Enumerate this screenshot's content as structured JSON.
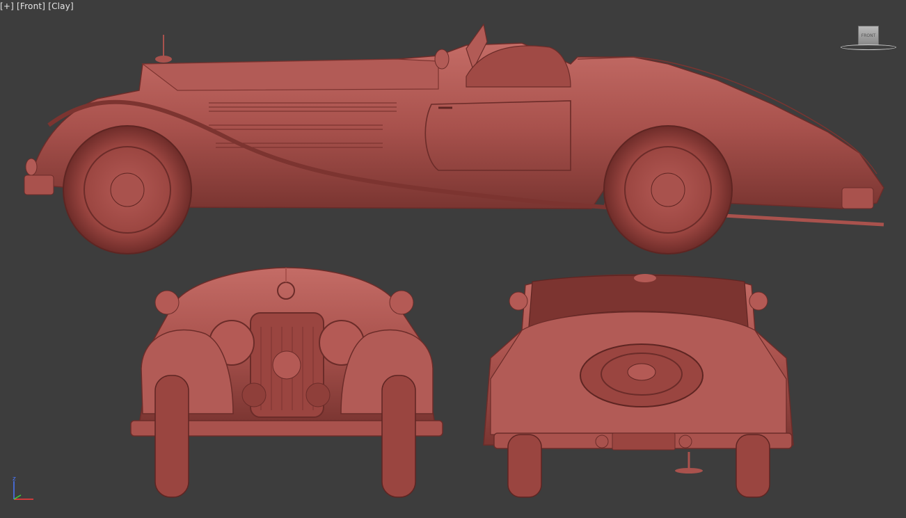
{
  "viewport": {
    "label_parts": [
      "[+]",
      "[Front]",
      "[Clay]"
    ],
    "viewcube_face": "FRONT",
    "axis_z": "z"
  },
  "colors": {
    "background": "#3d3d3d",
    "clay": "#a9524d",
    "clay_dark": "#7c3430",
    "clay_light": "#c7706a",
    "clay_shadow": "#5e2522"
  },
  "icons": {
    "viewcube": "viewcube-icon",
    "axis": "axis-tripod-icon"
  }
}
